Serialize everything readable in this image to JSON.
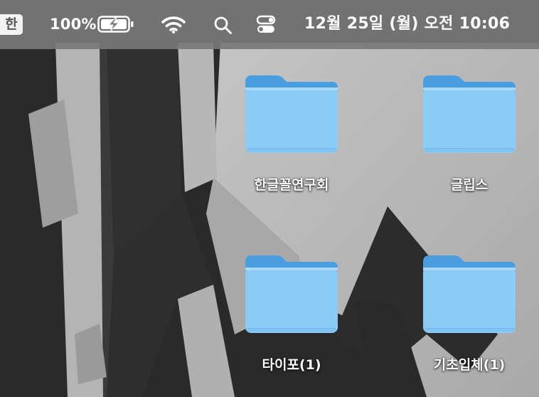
{
  "menubar": {
    "input_source": "한",
    "battery_percent": "100%",
    "battery_icon": "battery-charging-icon",
    "wifi_icon": "wifi-icon",
    "search_icon": "spotlight-search-icon",
    "control_center_icon": "control-center-icon",
    "datetime": "12월 25일 (월) 오전 10:06"
  },
  "desktop": {
    "items": [
      {
        "label": "한글꼴연구회",
        "icon": "folder-icon"
      },
      {
        "label": "글립스",
        "icon": "folder-icon"
      },
      {
        "label": "타이포(1)",
        "icon": "folder-icon"
      },
      {
        "label": "기초입체(1)",
        "icon": "folder-icon"
      }
    ]
  },
  "colors": {
    "folder_body": "#8ccbf5",
    "folder_tab": "#4a9ee0",
    "menubar": "#787878",
    "wallpaper_light": "#b9b9b9",
    "wallpaper_dark": "#262626"
  }
}
